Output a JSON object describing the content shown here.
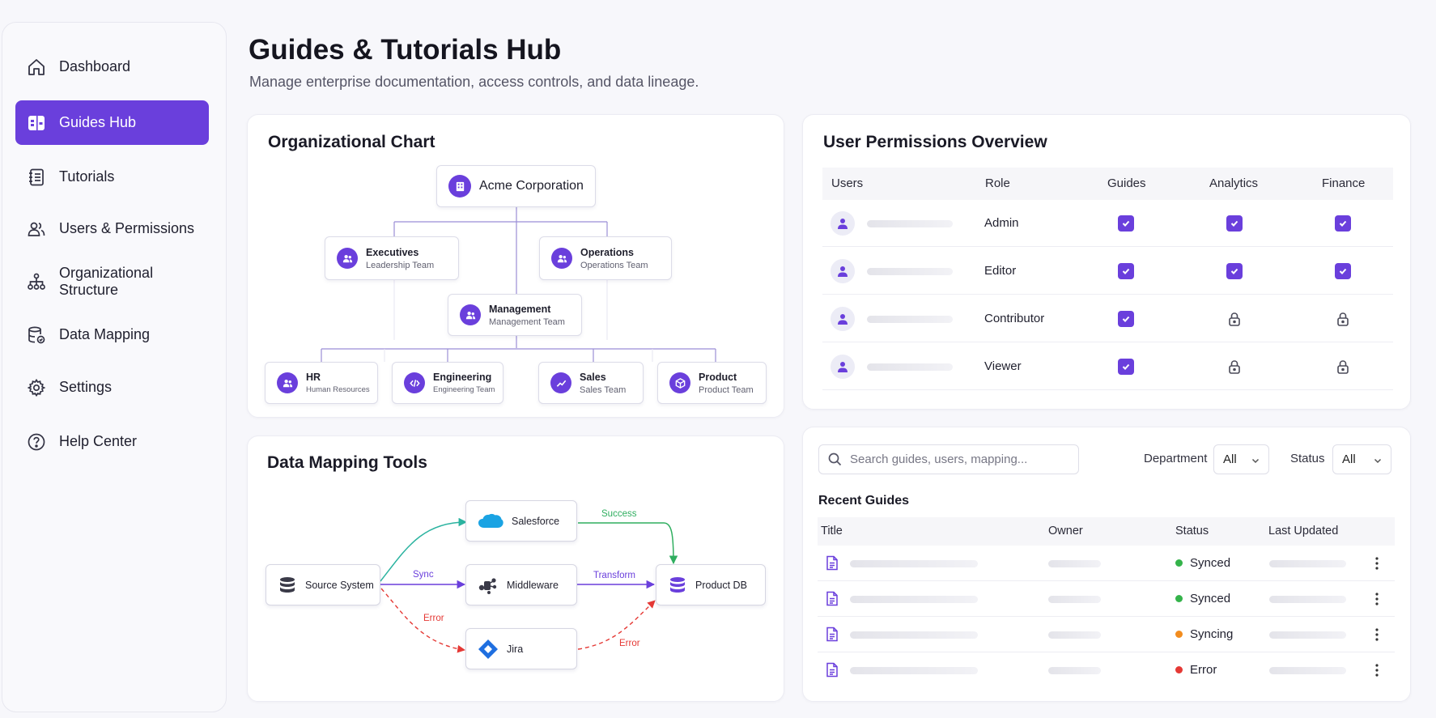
{
  "sidebar": {
    "items": [
      {
        "label": "Dashboard",
        "icon": "home-icon",
        "active": false
      },
      {
        "label": "Guides Hub",
        "icon": "guides-icon",
        "active": true
      },
      {
        "label": "Tutorials",
        "icon": "list-icon",
        "active": false
      },
      {
        "label": "Users & Permissions",
        "icon": "users-icon",
        "active": false
      },
      {
        "label": "Organizational Structure",
        "icon": "hierarchy-icon",
        "active": false
      },
      {
        "label": "Data Mapping",
        "icon": "database-icon",
        "active": false
      },
      {
        "label": "Settings",
        "icon": "gear-icon",
        "active": false
      },
      {
        "label": "Help Center",
        "icon": "help-icon",
        "active": false
      }
    ]
  },
  "header": {
    "title": "Guides & Tutorials Hub",
    "subtitle": "Manage enterprise documentation, access controls, and data lineage."
  },
  "org_chart": {
    "title": "Organizational Chart",
    "root": "Acme Corporation",
    "nodes": {
      "executives": {
        "name": "Executives",
        "team": "Leadership Team"
      },
      "operations": {
        "name": "Operations",
        "team": "Operations Team"
      },
      "management": {
        "name": "Management",
        "team": "Management Team"
      },
      "hr": {
        "name": "HR",
        "team": "Human Resources"
      },
      "engineering": {
        "name": "Engineering",
        "team": "Engineering Team"
      },
      "sales": {
        "name": "Sales",
        "team": "Sales Team"
      },
      "product": {
        "name": "Product",
        "team": "Product Team"
      }
    }
  },
  "data_mapping": {
    "title": "Data Mapping Tools",
    "nodes": {
      "source": "Source System",
      "salesforce": "Salesforce",
      "middleware": "Middleware",
      "jira": "Jira",
      "product_db": "Product DB"
    },
    "flows": {
      "sync": "Sync",
      "transform": "Transform",
      "success": "Success",
      "error_in": "Error",
      "error_out": "Error"
    },
    "colors": {
      "sync": "#6a3fdc",
      "success": "#2fae5f",
      "error": "#e53935",
      "source_to_salesforce": "#2bb3a0"
    }
  },
  "permissions": {
    "title": "User Permissions Overview",
    "columns": [
      "Users",
      "Role",
      "Guides",
      "Analytics",
      "Finance"
    ],
    "rows": [
      {
        "role": "Admin",
        "guides": "check",
        "analytics": "check",
        "finance": "check"
      },
      {
        "role": "Editor",
        "guides": "check",
        "analytics": "check",
        "finance": "check"
      },
      {
        "role": "Contributor",
        "guides": "check",
        "analytics": "lock",
        "finance": "lock"
      },
      {
        "role": "Viewer",
        "guides": "check",
        "analytics": "lock",
        "finance": "lock"
      }
    ]
  },
  "guides": {
    "search_placeholder": "Search guides, users, mapping...",
    "department_label": "Department",
    "department_value": "All",
    "status_label": "Status",
    "status_value": "All",
    "section_title": "Recent Guides",
    "columns": [
      "Title",
      "Owner",
      "Status",
      "Last Updated"
    ],
    "rows": [
      {
        "status": "Synced",
        "color": "#34b34a"
      },
      {
        "status": "Synced",
        "color": "#34b34a"
      },
      {
        "status": "Syncing",
        "color": "#f28c1e"
      },
      {
        "status": "Error",
        "color": "#e53935"
      }
    ]
  },
  "theme": {
    "accent": "#6a3fdc"
  }
}
